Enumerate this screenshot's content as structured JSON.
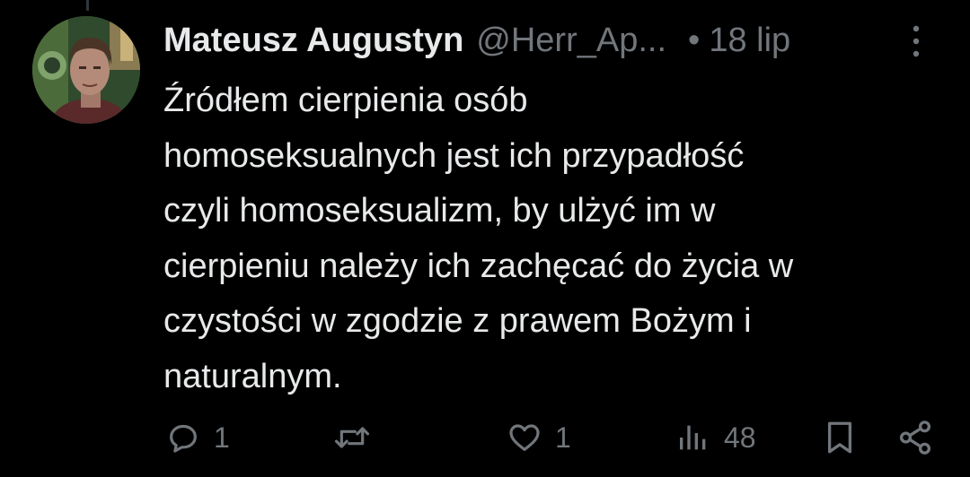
{
  "tweet": {
    "author": {
      "display_name": "Mateusz Augustyn",
      "handle": "@Herr_Ap...",
      "avatar_icon": "avatar-photo"
    },
    "separator": "•",
    "time": "18 lip",
    "text_lines": [
      "Źródłem cierpienia osób",
      "homoseksualnych jest ich przypadłość",
      "czyli homoseksualizm, by ulżyć im w",
      "cierpieniu należy ich zachęcać do życia w",
      "czystości w zgodzie z prawem Bożym i",
      "naturalnym."
    ],
    "actions": {
      "reply": {
        "icon": "reply-icon",
        "count": "1"
      },
      "retweet": {
        "icon": "retweet-icon",
        "count": ""
      },
      "like": {
        "icon": "heart-icon",
        "count": "1"
      },
      "views": {
        "icon": "views-icon",
        "count": "48"
      },
      "bookmark": {
        "icon": "bookmark-icon"
      },
      "share": {
        "icon": "share-icon"
      }
    }
  },
  "colors": {
    "background": "#000000",
    "text_primary": "#e7e9ea",
    "text_secondary": "#71767b"
  }
}
